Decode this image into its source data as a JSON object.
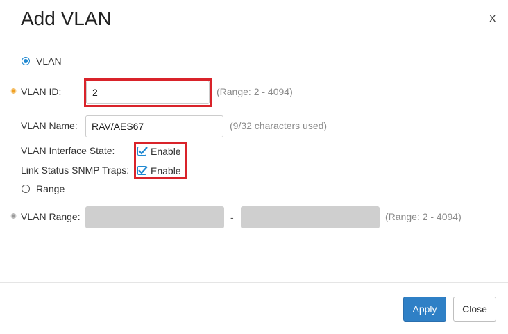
{
  "dialog": {
    "title": "Add VLAN",
    "close_label": "X"
  },
  "form": {
    "vlan_option_label": "VLAN",
    "vlan_id": {
      "label": "VLAN ID:",
      "value": "2",
      "hint": "(Range: 2 - 4094)"
    },
    "vlan_name": {
      "label": "VLAN Name:",
      "value": "RAV/AES67",
      "hint": "(9/32 characters used)"
    },
    "interface_state": {
      "label": "VLAN Interface State:",
      "checkbox_label": "Enable",
      "checked": true
    },
    "snmp_traps": {
      "label": "Link Status SNMP Traps:",
      "checkbox_label": "Enable",
      "checked": true
    },
    "range_option_label": "Range",
    "vlan_range": {
      "label": "VLAN Range:",
      "separator": "-",
      "start_value": "",
      "end_value": "",
      "hint": "(Range: 2 - 4094)"
    }
  },
  "footer": {
    "apply_label": "Apply",
    "close_label": "Close"
  },
  "colors": {
    "accent": "#2f80c6",
    "required_active": "#f0a020",
    "required_inactive": "#9a9a9a",
    "highlight": "#d9232a"
  }
}
